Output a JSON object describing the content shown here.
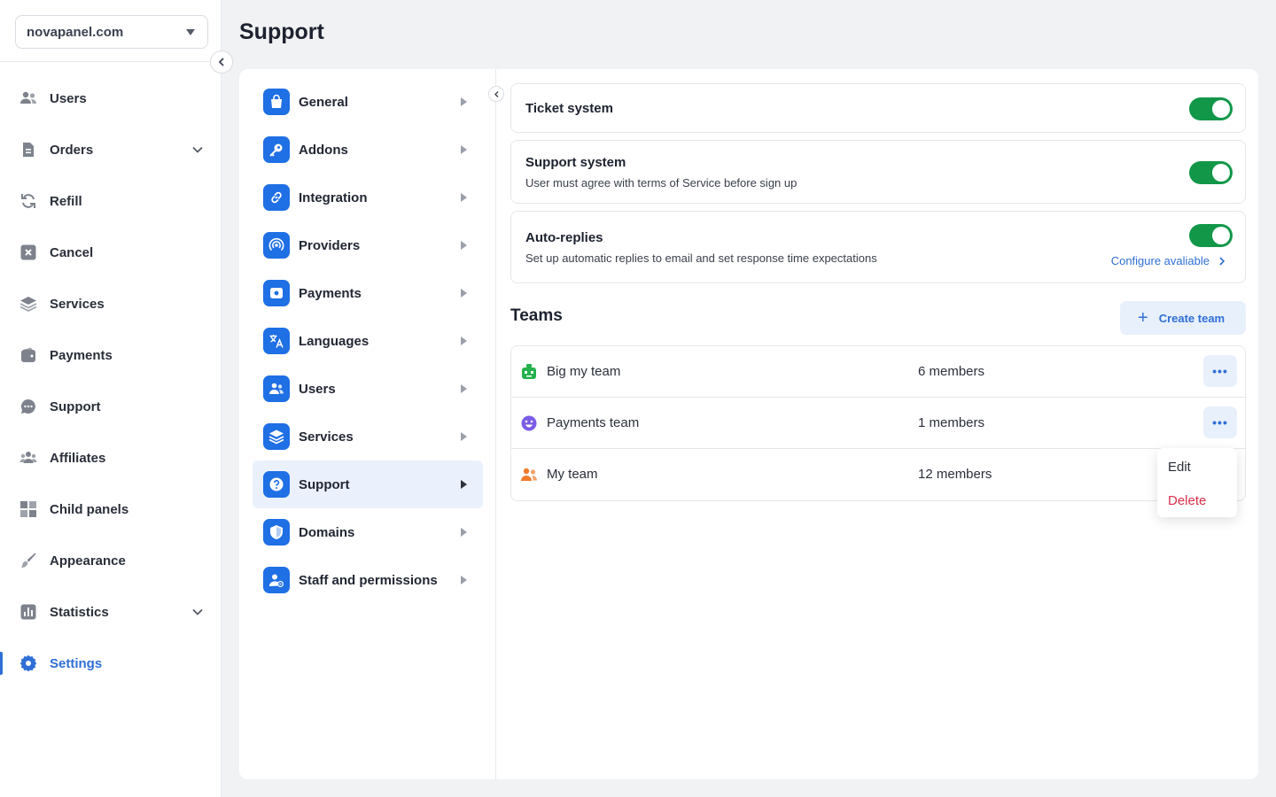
{
  "domain_select": {
    "value": "novapanel.com"
  },
  "sidebar": {
    "items": [
      {
        "label": "Users",
        "icon": "users-icon"
      },
      {
        "label": "Orders",
        "icon": "orders-icon",
        "expandable": true
      },
      {
        "label": "Refill",
        "icon": "refill-icon"
      },
      {
        "label": "Cancel",
        "icon": "cancel-icon"
      },
      {
        "label": "Services",
        "icon": "services-icon"
      },
      {
        "label": "Payments",
        "icon": "wallet-icon"
      },
      {
        "label": "Support",
        "icon": "chat-icon"
      },
      {
        "label": "Affiliates",
        "icon": "affiliates-icon"
      },
      {
        "label": "Child panels",
        "icon": "panels-icon"
      },
      {
        "label": "Appearance",
        "icon": "brush-icon"
      },
      {
        "label": "Statistics",
        "icon": "statistics-icon",
        "expandable": true
      },
      {
        "label": "Settings",
        "icon": "settings-icon",
        "active": true
      }
    ]
  },
  "page": {
    "title": "Support"
  },
  "settings_menu": {
    "items": [
      {
        "label": "General",
        "icon": "bag-icon"
      },
      {
        "label": "Addons",
        "icon": "key-icon"
      },
      {
        "label": "Integration",
        "icon": "link-icon"
      },
      {
        "label": "Providers",
        "icon": "broadcast-icon"
      },
      {
        "label": "Payments",
        "icon": "payment-icon"
      },
      {
        "label": "Languages",
        "icon": "translate-icon"
      },
      {
        "label": "Users",
        "icon": "users-icon"
      },
      {
        "label": "Services",
        "icon": "layers-icon"
      },
      {
        "label": "Support",
        "icon": "question-icon",
        "active": true
      },
      {
        "label": "Domains",
        "icon": "shield-icon"
      },
      {
        "label": "Staff and permissions",
        "icon": "staff-icon"
      }
    ]
  },
  "support": {
    "ticket_system": {
      "title": "Ticket system",
      "enabled": true
    },
    "support_system": {
      "title": "Support system",
      "description": "User must agree with terms of  Service before sign up",
      "enabled": true
    },
    "auto_replies": {
      "title": "Auto-replies",
      "description": "Set up automatic replies to email and set response time expectations",
      "link": "Configure avaliable",
      "enabled": true
    }
  },
  "teams": {
    "title": "Teams",
    "create_label": "Create team",
    "rows": [
      {
        "name": "Big my team",
        "members": "6 members",
        "icon": "robot-icon",
        "icon_color": "#22b14c"
      },
      {
        "name": "Payments team",
        "members": "1 members",
        "icon": "smiley-icon",
        "icon_color": "#7b5ce6"
      },
      {
        "name": "My team",
        "members": "12 members",
        "icon": "team-icon",
        "icon_color": "#f07b2c"
      }
    ]
  },
  "row_menu": {
    "edit": "Edit",
    "delete": "Delete"
  },
  "colors": {
    "accent": "#2f6fd6",
    "toggle_on": "#129749",
    "danger": "#d9304a"
  }
}
